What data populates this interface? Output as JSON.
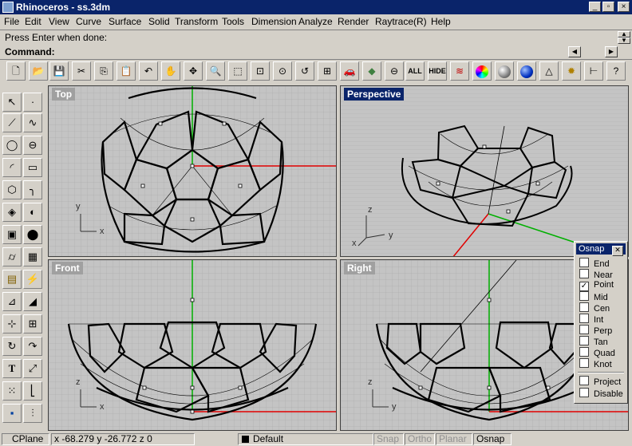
{
  "window": {
    "title": "Rhinoceros - ss.3dm"
  },
  "menu": [
    "File",
    "Edit",
    "View",
    "Curve",
    "Surface",
    "Solid",
    "Transform",
    "Tools",
    "Dimension",
    "Analyze",
    "Render",
    "Raytrace(R)",
    "Help"
  ],
  "command_history": "Press Enter when done:",
  "command_prompt": "Command:",
  "toolbar": {
    "all_label": "ALL",
    "hide_label": "HIDE"
  },
  "viewports": {
    "top": "Top",
    "perspective": "Perspective",
    "front": "Front",
    "right": "Right"
  },
  "osnap": {
    "title": "Osnap",
    "close": "✕",
    "items": [
      {
        "label": "End",
        "checked": false
      },
      {
        "label": "Near",
        "checked": false
      },
      {
        "label": "Point",
        "checked": true
      },
      {
        "label": "Mid",
        "checked": false
      },
      {
        "label": "Cen",
        "checked": false
      },
      {
        "label": "Int",
        "checked": false
      },
      {
        "label": "Perp",
        "checked": false
      },
      {
        "label": "Tan",
        "checked": false
      },
      {
        "label": "Quad",
        "checked": false
      },
      {
        "label": "Knot",
        "checked": false
      }
    ],
    "extra": [
      {
        "label": "Project",
        "checked": false
      },
      {
        "label": "Disable",
        "checked": false
      }
    ]
  },
  "status": {
    "cplane": "CPlane",
    "coords": "x -68.279  y -26.772  z 0",
    "layer": "Default",
    "snap": "Snap",
    "ortho": "Ortho",
    "planar": "Planar",
    "osnap": "Osnap"
  },
  "colors": {
    "x_axis": "#e00000",
    "y_axis": "#00c000",
    "active_viewport": "#0a246a"
  }
}
